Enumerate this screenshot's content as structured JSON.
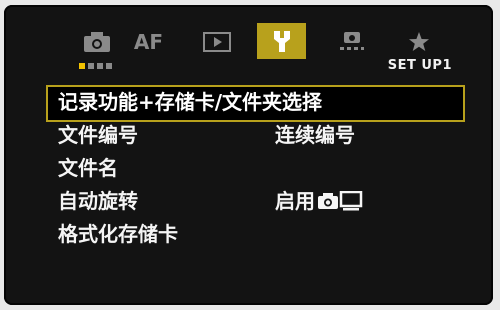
{
  "tabs": [
    {
      "id": "shooting",
      "icon": "camera-icon",
      "active": false
    },
    {
      "id": "af",
      "label": "AF",
      "active": false
    },
    {
      "id": "playback",
      "icon": "playback-icon",
      "active": false
    },
    {
      "id": "setup",
      "icon": "wrench-icon",
      "active": true
    },
    {
      "id": "custom",
      "icon": "custom-functions-icon",
      "active": false
    },
    {
      "id": "mymenu",
      "icon": "star-icon",
      "active": false
    }
  ],
  "page_indicator": {
    "pages": 4,
    "current": 1
  },
  "section_title": "SET UP1",
  "menu": {
    "items": [
      {
        "label": "记录功能+存储卡/文件夹选择",
        "value": "",
        "selected": true
      },
      {
        "label": "文件编号",
        "value": "连续编号"
      },
      {
        "label": "文件名",
        "value": ""
      },
      {
        "label": "自动旋转",
        "value": "启用",
        "value_icons": [
          "camera-icon",
          "monitor-icon"
        ]
      },
      {
        "label": "格式化存储卡",
        "value": ""
      }
    ]
  },
  "colors": {
    "accent": "#b8a11c",
    "indicator": "#f2c200",
    "background": "#131313"
  }
}
